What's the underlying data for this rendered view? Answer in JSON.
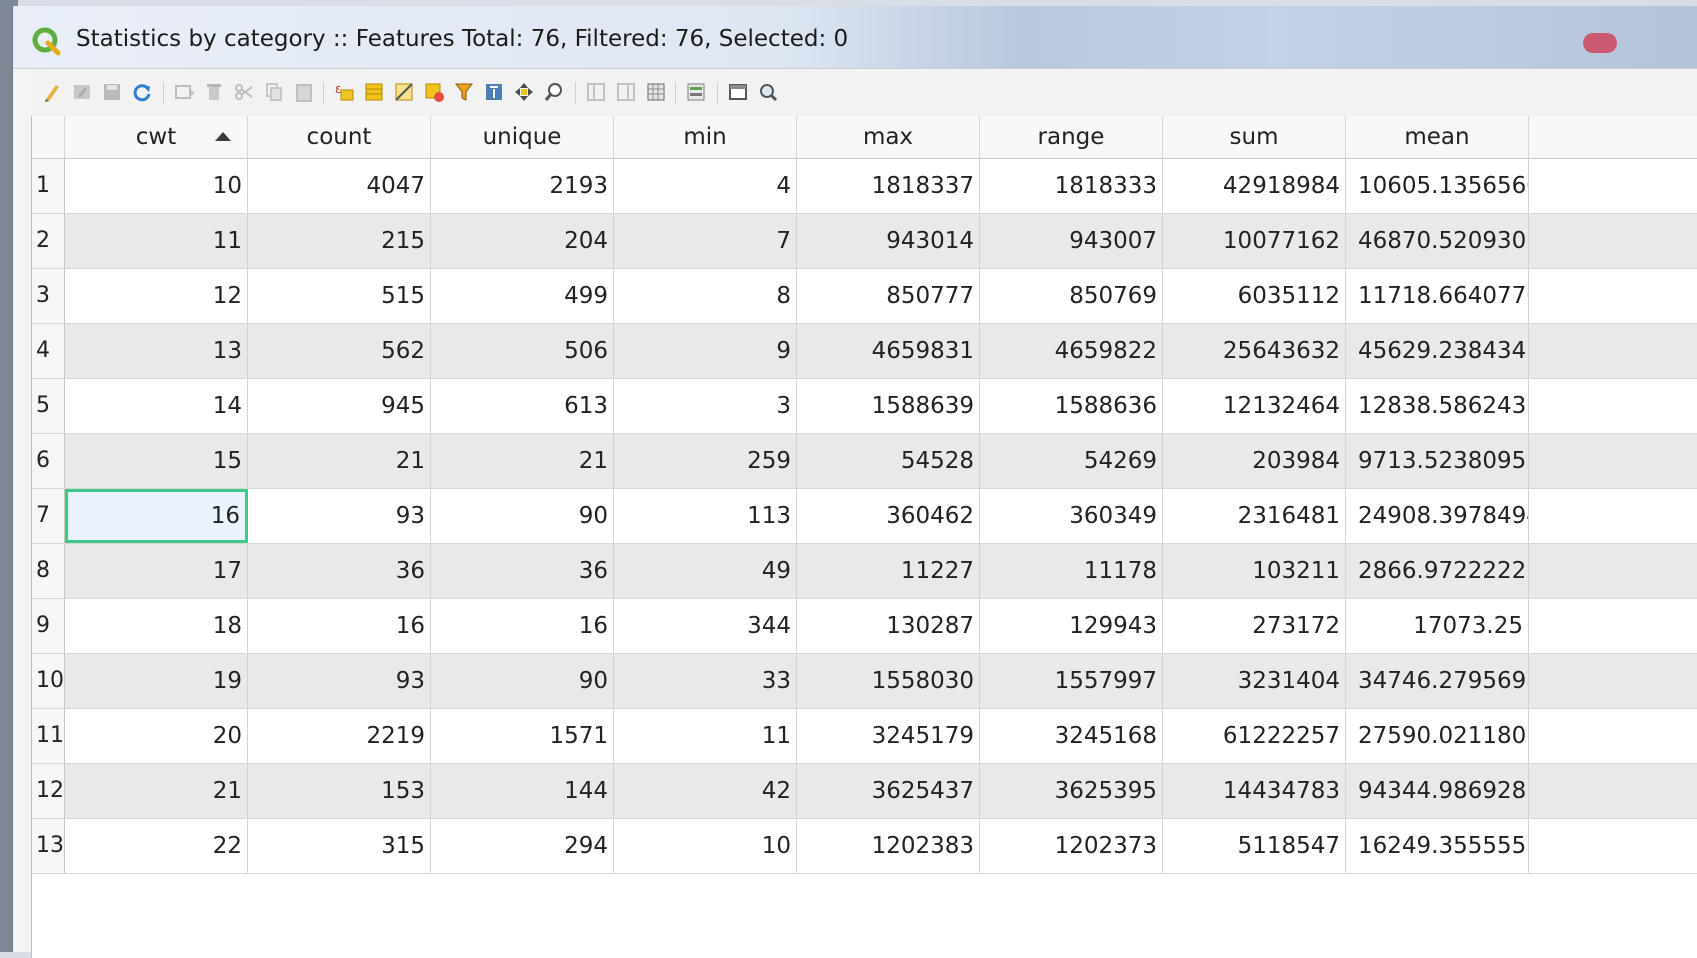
{
  "window": {
    "title": "Statistics by category :: Features Total: 76, Filtered: 76, Selected: 0",
    "accent_color": "#3ccb87"
  },
  "toolbar": {
    "icons": [
      "pencil-icon",
      "multi-edit-icon",
      "save-icon",
      "reload-icon",
      "add-feature-icon",
      "delete-feature-icon",
      "cut-icon",
      "copy-icon",
      "paste-icon",
      "expression-select-icon",
      "select-all-icon",
      "invert-selection-icon",
      "deselect-icon",
      "filter-icon",
      "move-top-icon",
      "pan-to-icon",
      "zoom-to-icon",
      "new-field-icon",
      "delete-field-icon",
      "field-calculator-icon",
      "conditional-format-icon",
      "dock-icon",
      "actions-icon"
    ]
  },
  "table": {
    "columns": [
      "cwt",
      "count",
      "unique",
      "min",
      "max",
      "range",
      "sum",
      "mean"
    ],
    "sorted_column": "cwt",
    "sort_direction": "ascending",
    "selected_cell": {
      "row": 7,
      "column": "cwt"
    },
    "rows": [
      {
        "n": "1",
        "cwt": "10",
        "count": "4047",
        "unique": "2193",
        "min": "4",
        "max": "1818337",
        "range": "1818333",
        "sum": "42918984",
        "mean": "10605.1356560..."
      },
      {
        "n": "2",
        "cwt": "11",
        "count": "215",
        "unique": "204",
        "min": "7",
        "max": "943014",
        "range": "943007",
        "sum": "10077162",
        "mean": "46870.5209302..."
      },
      {
        "n": "3",
        "cwt": "12",
        "count": "515",
        "unique": "499",
        "min": "8",
        "max": "850777",
        "range": "850769",
        "sum": "6035112",
        "mean": "11718.6640776..."
      },
      {
        "n": "4",
        "cwt": "13",
        "count": "562",
        "unique": "506",
        "min": "9",
        "max": "4659831",
        "range": "4659822",
        "sum": "25643632",
        "mean": "45629.2384341..."
      },
      {
        "n": "5",
        "cwt": "14",
        "count": "945",
        "unique": "613",
        "min": "3",
        "max": "1588639",
        "range": "1588636",
        "sum": "12132464",
        "mean": "12838.5862433..."
      },
      {
        "n": "6",
        "cwt": "15",
        "count": "21",
        "unique": "21",
        "min": "259",
        "max": "54528",
        "range": "54269",
        "sum": "203984",
        "mean": "9713.52380952..."
      },
      {
        "n": "7",
        "cwt": "16",
        "count": "93",
        "unique": "90",
        "min": "113",
        "max": "360462",
        "range": "360349",
        "sum": "2316481",
        "mean": "24908.3978494..."
      },
      {
        "n": "8",
        "cwt": "17",
        "count": "36",
        "unique": "36",
        "min": "49",
        "max": "11227",
        "range": "11178",
        "sum": "103211",
        "mean": "2866.97222222..."
      },
      {
        "n": "9",
        "cwt": "18",
        "count": "16",
        "unique": "16",
        "min": "344",
        "max": "130287",
        "range": "129943",
        "sum": "273172",
        "mean": "17073.25"
      },
      {
        "n": "10",
        "cwt": "19",
        "count": "93",
        "unique": "90",
        "min": "33",
        "max": "1558030",
        "range": "1557997",
        "sum": "3231404",
        "mean": "34746.2795698..."
      },
      {
        "n": "11",
        "cwt": "20",
        "count": "2219",
        "unique": "1571",
        "min": "11",
        "max": "3245179",
        "range": "3245168",
        "sum": "61222257",
        "mean": "27590.0211807..."
      },
      {
        "n": "12",
        "cwt": "21",
        "count": "153",
        "unique": "144",
        "min": "42",
        "max": "3625437",
        "range": "3625395",
        "sum": "14434783",
        "mean": "94344.9869281..."
      },
      {
        "n": "13",
        "cwt": "22",
        "count": "315",
        "unique": "294",
        "min": "10",
        "max": "1202383",
        "range": "1202373",
        "sum": "5118547",
        "mean": "16249.3555555..."
      }
    ]
  }
}
